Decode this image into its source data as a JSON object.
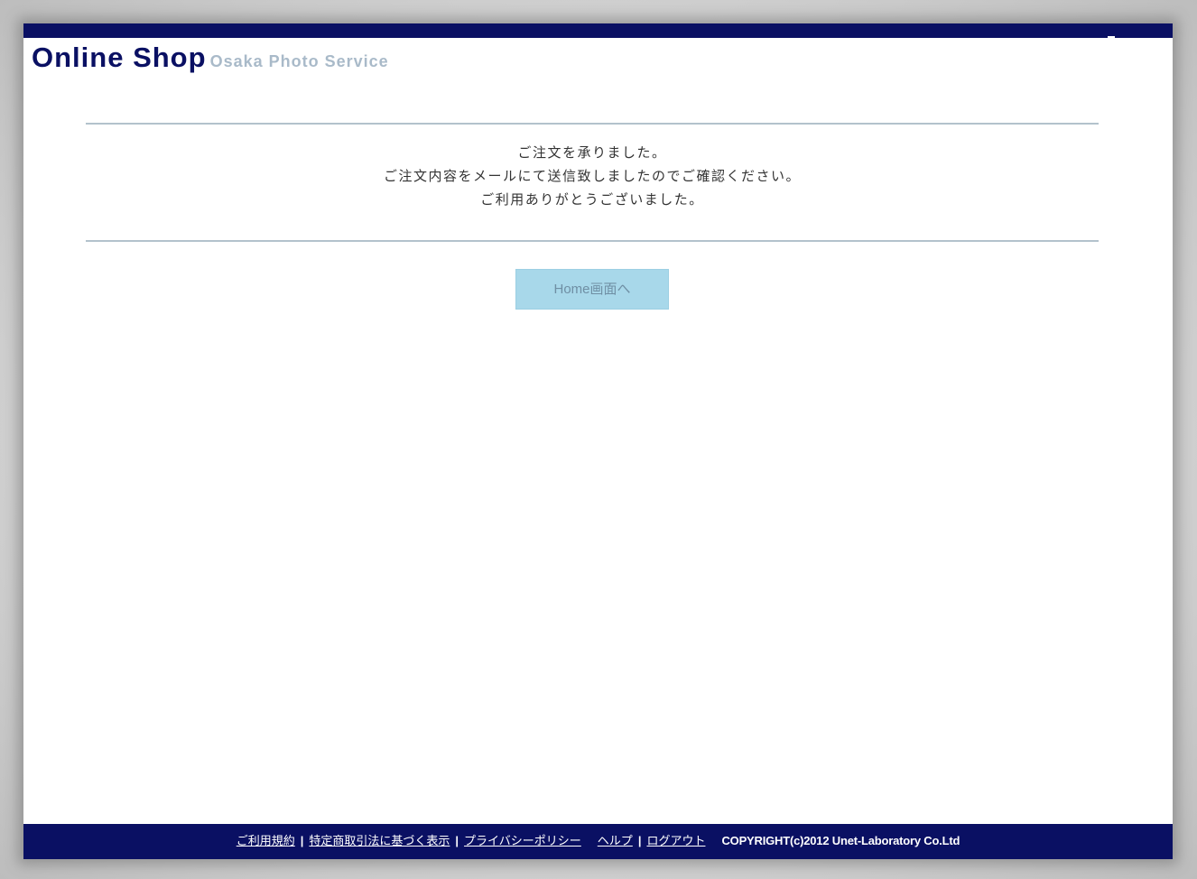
{
  "header": {
    "title": "Online Shop",
    "subtitle": "Osaka Photo Service"
  },
  "message": {
    "lines": [
      "ご注文を承りました。",
      "ご注文内容をメールにて送信致しましたのでご確認ください。",
      "ご利用ありがとうございました。"
    ]
  },
  "actions": {
    "home_label": "Home画面へ"
  },
  "footer": {
    "links": [
      "ご利用規約",
      "特定商取引法に基づく表示",
      "プライバシーポリシー",
      "ヘルプ",
      "ログアウト"
    ],
    "separator": "|",
    "copyright": "COPYRIGHT(c)2012 Unet-Laboratory Co.Ltd"
  },
  "colors": {
    "brand_navy": "#0a1063",
    "subtitle_gray": "#a9bac9",
    "button_bg": "#a8d8ea",
    "rule": "#b3c2cc"
  }
}
